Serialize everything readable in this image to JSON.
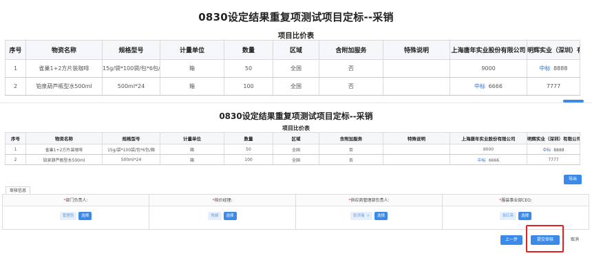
{
  "title": "0830设定结果重复项测试项目定标--采销",
  "subtitle": "项目比价表",
  "headers": [
    "序号",
    "物资名称",
    "规格型号",
    "计量单位",
    "数量",
    "区域",
    "含附加服务",
    "特殊说明",
    "上海唐年实业股份有限公司",
    "明辉实业（深圳）有限公司"
  ],
  "rows": [
    {
      "no": "1",
      "name": "雀巢1+2方片装咖啡",
      "spec": "15g/袋*100袋/包*6包/箱",
      "unit": "箱",
      "qty": "50",
      "region": "全国",
      "service": "否",
      "note": "",
      "s1_tag": "",
      "s1_price": "9000",
      "s2_tag": "中标",
      "s2_price": "8888"
    },
    {
      "no": "2",
      "name": "铂泉葫芦瓶型水500ml",
      "spec": "500ml*24",
      "unit": "箱",
      "qty": "100",
      "region": "全国",
      "service": "否",
      "note": "",
      "s1_tag": "中标",
      "s1_price": "6666",
      "s2_tag": "",
      "s2_price": "7777"
    }
  ],
  "export_label": "导出",
  "audit": {
    "tab_label": "审核信息",
    "columns": [
      {
        "required": "*",
        "label": "部门负责人:",
        "person": "管理员",
        "removable": "",
        "button": "选择"
      },
      {
        "required": "*",
        "label": "核价经理:",
        "person": "陈颖",
        "removable": "",
        "button": "选择"
      },
      {
        "required": "*",
        "label": "供应商管理部负责人:",
        "person": "张洪瑞",
        "removable": "×",
        "button": "选择"
      },
      {
        "required": "*",
        "label": "服装事业部CEO:",
        "person": "张红英",
        "removable": "",
        "button": "选择"
      }
    ]
  },
  "actions": {
    "prev": "上一步",
    "submit": "提交审核",
    "cancel": "取消"
  },
  "colors": {
    "accent": "#3c8ae8",
    "win_text": "#2f6fd6",
    "highlight": "#e81c1c",
    "required": "#e23b3b"
  }
}
